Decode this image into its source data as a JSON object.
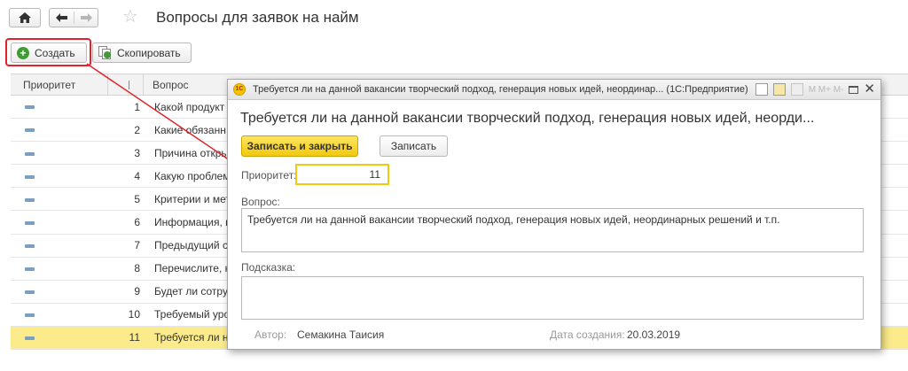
{
  "header": {
    "title": "Вопросы для заявок на найм"
  },
  "toolbar": {
    "create_label": "Создать",
    "copy_label": "Скопировать"
  },
  "list": {
    "columns": [
      "Приоритет",
      "",
      "Вопрос"
    ],
    "rows": [
      {
        "num": "1",
        "question": "Какой продукт"
      },
      {
        "num": "2",
        "question": "Какие обязанн"
      },
      {
        "num": "3",
        "question": "Причина откры"
      },
      {
        "num": "4",
        "question": "Какую проблем"
      },
      {
        "num": "5",
        "question": "Критерии и мет"
      },
      {
        "num": "6",
        "question": "Информация, г"
      },
      {
        "num": "7",
        "question": "Предыдущий с"
      },
      {
        "num": "8",
        "question": "Перечислите, к"
      },
      {
        "num": "9",
        "question": "Будет ли сотру"
      },
      {
        "num": "10",
        "question": "Требуемый уро"
      },
      {
        "num": "11",
        "question": "Требуется ли н"
      }
    ],
    "selected_index": 10
  },
  "modal": {
    "window_title": "Требуется ли на данной вакансии творческий подход, генерация новых идей, неординар...  (1С:Предприятие)",
    "titlebar_icons_text": "M  M+  M-",
    "heading": "Требуется ли на данной вакансии творческий подход, генерация новых идей, неорди...",
    "save_close_label": "Записать и закрыть",
    "save_label": "Записать",
    "priority_label": "Приоритет:",
    "priority_value": "11",
    "question_label": "Вопрос:",
    "question_value": "Требуется ли на данной вакансии творческий подход, генерация новых идей, неординарных решений и т.п.",
    "hint_label": "Подсказка:",
    "hint_value": "",
    "author_label": "Автор:",
    "author_value": "Семакина Таисия",
    "date_label": "Дата создания:",
    "date_value": "20.03.2019"
  },
  "colors": {
    "accent_yellow": "#f2c90e",
    "selected_row": "#fbeb8b",
    "annotation_red": "#e0232b",
    "create_green": "#3f9c35"
  },
  "icons": {
    "home": "home-icon",
    "back": "arrow-left-icon",
    "forward": "arrow-right-icon",
    "favorite": "star-icon",
    "create": "plus-circle-icon",
    "copy": "copy-icon",
    "priority": "dash-icon"
  }
}
